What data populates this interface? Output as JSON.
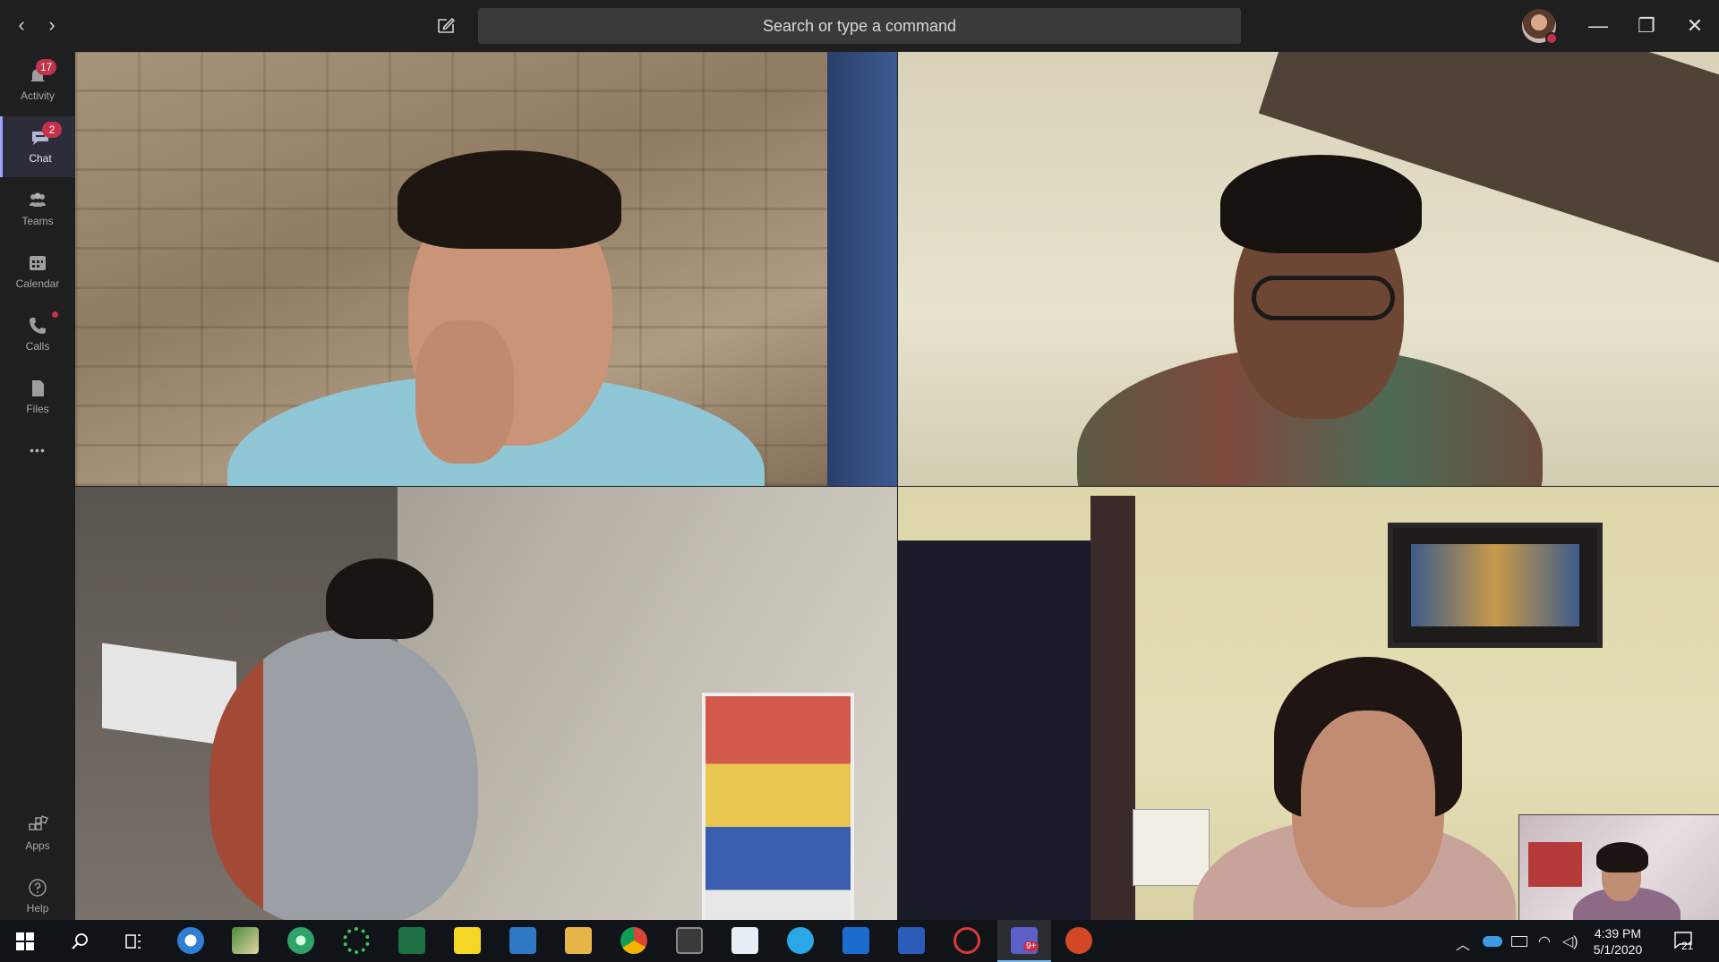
{
  "titlebar": {
    "back_glyph": "‹",
    "forward_glyph": "›",
    "search_placeholder": "Search or type a command",
    "minimize_glyph": "—",
    "restore_glyph": "❐",
    "close_glyph": "✕"
  },
  "rail": {
    "items": [
      {
        "label": "Activity",
        "icon": "bell-icon",
        "badge": "17"
      },
      {
        "label": "Chat",
        "icon": "chat-icon",
        "badge": "2",
        "active": true
      },
      {
        "label": "Teams",
        "icon": "teams-icon"
      },
      {
        "label": "Calendar",
        "icon": "calendar-icon"
      },
      {
        "label": "Calls",
        "icon": "phone-icon",
        "dot": true
      },
      {
        "label": "Files",
        "icon": "files-icon"
      }
    ],
    "more_glyph": "•••",
    "apps_label": "Apps",
    "help_label": "Help"
  },
  "taskbar": {
    "time": "4:39 PM",
    "date": "5/1/2020",
    "notifications": "21",
    "teams_badge": "9+"
  },
  "colors": {
    "accent": "#9ea2ff",
    "badge": "#c4314b",
    "chrome": "#1f1f1f"
  }
}
